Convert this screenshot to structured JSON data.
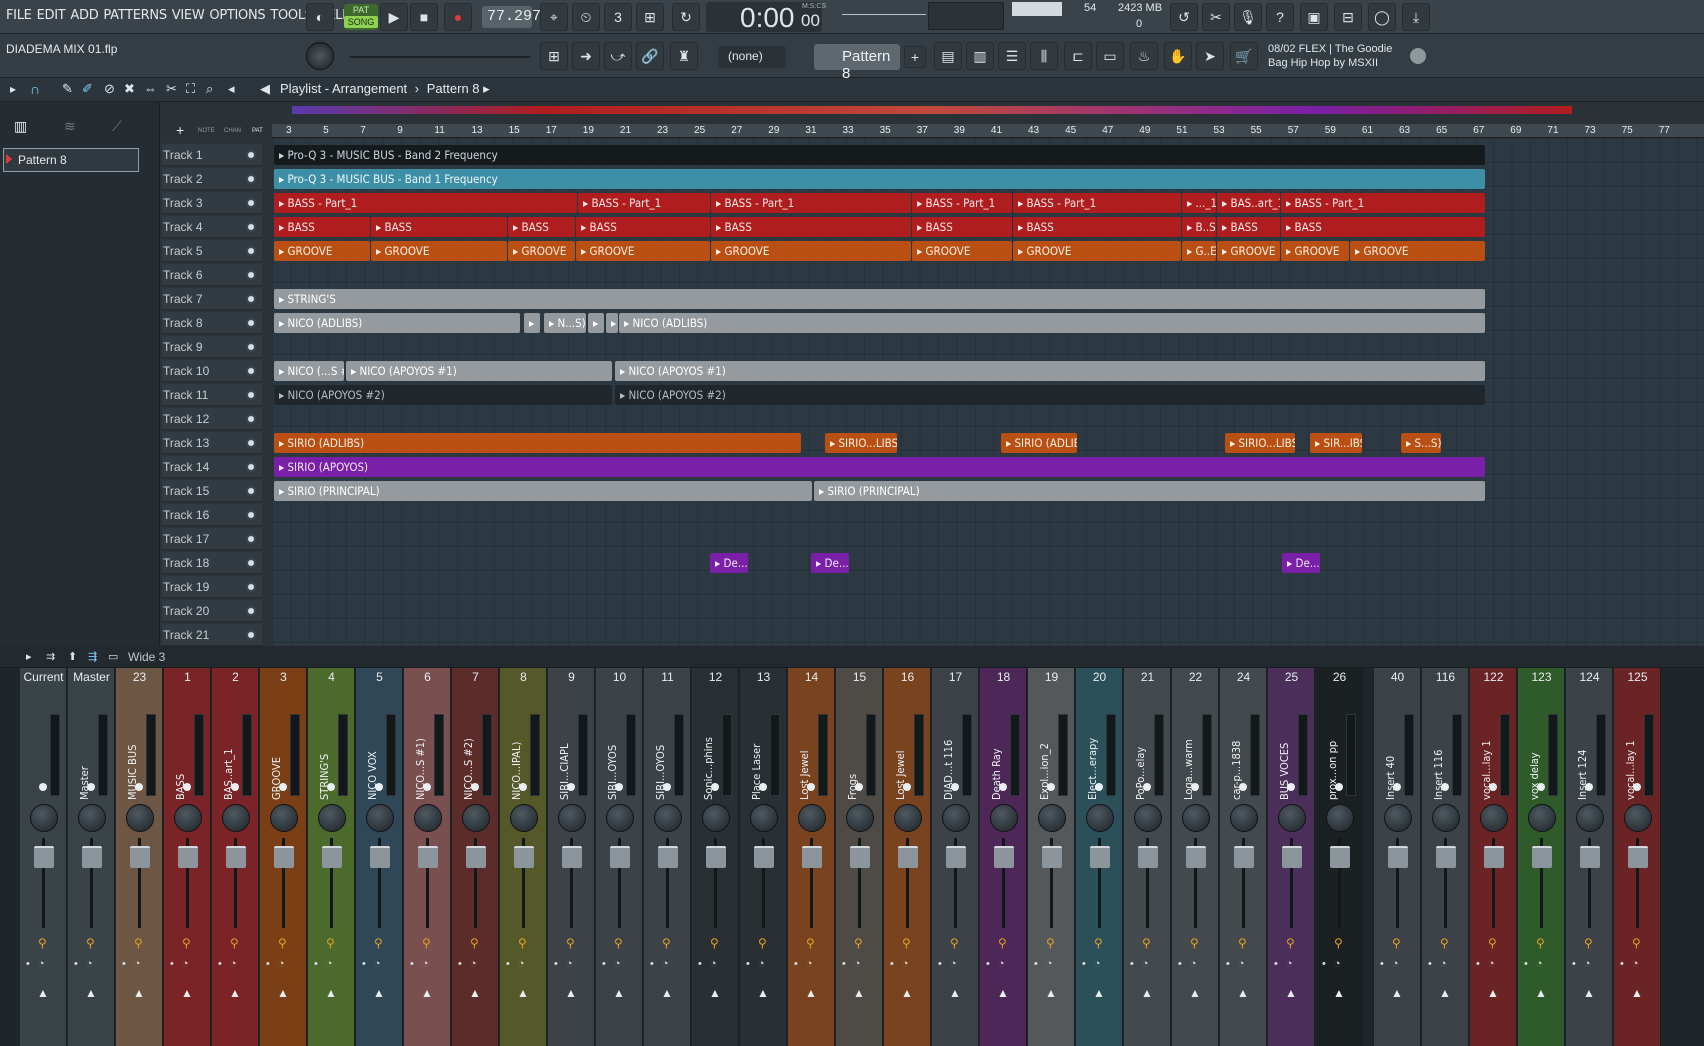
{
  "menu": [
    "FILE",
    "EDIT",
    "ADD",
    "PATTERNS",
    "VIEW",
    "OPTIONS",
    "TOOLS",
    "HELP"
  ],
  "transport": {
    "mode_top": "PAT",
    "mode_bottom": "SONG",
    "tempo": "77.297",
    "time": "0:00",
    "time_small": "00",
    "time_label": "M:S:CS",
    "cpu": "54",
    "memory": "2423 MB",
    "voices": "0"
  },
  "project": {
    "filename": "DIADEMA MIX 01.flp",
    "snap": "(none)",
    "pattern": "Pattern 8"
  },
  "news": {
    "line1": "08/02  FLEX | The Goodie",
    "line2": "Bag Hip Hop by MSXII"
  },
  "playlist": {
    "title": "Playlist - Arrangement",
    "separator": "›",
    "pattern": "Pattern 8",
    "left_labels": [
      "NOTE",
      "CHAN",
      "PAT"
    ]
  },
  "pattern_list": [
    {
      "label": "Pattern 8"
    }
  ],
  "ruler": [
    "3",
    "5",
    "7",
    "9",
    "11",
    "13",
    "15",
    "17",
    "19",
    "21",
    "23",
    "25",
    "27",
    "29",
    "31",
    "33",
    "35",
    "37",
    "39",
    "41",
    "43",
    "45",
    "47",
    "49",
    "51",
    "53",
    "55",
    "57",
    "59",
    "61",
    "63",
    "65",
    "67",
    "69",
    "71",
    "73",
    "75",
    "77"
  ],
  "tracks": [
    "Track 1",
    "Track 2",
    "Track 3",
    "Track 4",
    "Track 5",
    "Track 6",
    "Track 7",
    "Track 8",
    "Track 9",
    "Track 10",
    "Track 11",
    "Track 12",
    "Track 13",
    "Track 14",
    "Track 15",
    "Track 16",
    "Track 17",
    "Track 18",
    "Track 19",
    "Track 20",
    "Track 21"
  ],
  "clips": [
    {
      "row": 0,
      "start": 0,
      "len": 1211,
      "label": "Pro-Q 3 - MUSIC BUS - Band 2 Frequency",
      "color": "black"
    },
    {
      "row": 1,
      "start": 0,
      "len": 1211,
      "label": "Pro-Q 3 - MUSIC BUS - Band 1 Frequency",
      "color": "blue"
    },
    {
      "row": 2,
      "start": 0,
      "len": 303,
      "label": "BASS - Part_1",
      "color": "red"
    },
    {
      "row": 2,
      "start": 304,
      "len": 132,
      "label": "BASS - Part_1",
      "color": "red"
    },
    {
      "row": 2,
      "start": 437,
      "len": 200,
      "label": "BASS - Part_1",
      "color": "red"
    },
    {
      "row": 2,
      "start": 638,
      "len": 100,
      "label": "BASS - Part_1",
      "color": "red"
    },
    {
      "row": 2,
      "start": 739,
      "len": 168,
      "label": "BASS - Part_1",
      "color": "red"
    },
    {
      "row": 2,
      "start": 908,
      "len": 34,
      "label": "..._1",
      "color": "red"
    },
    {
      "row": 2,
      "start": 943,
      "len": 63,
      "label": "BAS..art_1",
      "color": "red"
    },
    {
      "row": 2,
      "start": 1007,
      "len": 204,
      "label": "BASS - Part_1",
      "color": "red"
    },
    {
      "row": 3,
      "start": 0,
      "len": 96,
      "label": "BASS",
      "color": "red"
    },
    {
      "row": 3,
      "start": 97,
      "len": 136,
      "label": "BASS",
      "color": "red"
    },
    {
      "row": 3,
      "start": 234,
      "len": 67,
      "label": "BASS",
      "color": "red"
    },
    {
      "row": 3,
      "start": 302,
      "len": 134,
      "label": "BASS",
      "color": "red"
    },
    {
      "row": 3,
      "start": 437,
      "len": 200,
      "label": "BASS",
      "color": "red"
    },
    {
      "row": 3,
      "start": 638,
      "len": 100,
      "label": "BASS",
      "color": "red"
    },
    {
      "row": 3,
      "start": 739,
      "len": 168,
      "label": "BASS",
      "color": "red"
    },
    {
      "row": 3,
      "start": 908,
      "len": 34,
      "label": "B..S",
      "color": "red"
    },
    {
      "row": 3,
      "start": 943,
      "len": 63,
      "label": "BASS",
      "color": "red"
    },
    {
      "row": 3,
      "start": 1007,
      "len": 204,
      "label": "BASS",
      "color": "red"
    },
    {
      "row": 4,
      "start": 0,
      "len": 96,
      "label": "GROOVE",
      "color": "orange"
    },
    {
      "row": 4,
      "start": 97,
      "len": 136,
      "label": "GROOVE",
      "color": "orange"
    },
    {
      "row": 4,
      "start": 234,
      "len": 67,
      "label": "GROOVE",
      "color": "orange"
    },
    {
      "row": 4,
      "start": 302,
      "len": 134,
      "label": "GROOVE",
      "color": "orange"
    },
    {
      "row": 4,
      "start": 437,
      "len": 200,
      "label": "GROOVE",
      "color": "orange"
    },
    {
      "row": 4,
      "start": 638,
      "len": 100,
      "label": "GROOVE",
      "color": "orange"
    },
    {
      "row": 4,
      "start": 739,
      "len": 168,
      "label": "GROOVE",
      "color": "orange"
    },
    {
      "row": 4,
      "start": 908,
      "len": 34,
      "label": "G..E",
      "color": "orange"
    },
    {
      "row": 4,
      "start": 943,
      "len": 63,
      "label": "GROOVE",
      "color": "orange"
    },
    {
      "row": 4,
      "start": 1007,
      "len": 68,
      "label": "GROOVE",
      "color": "orange"
    },
    {
      "row": 4,
      "start": 1076,
      "len": 135,
      "label": "GROOVE",
      "color": "orange"
    },
    {
      "row": 6,
      "start": 0,
      "len": 1211,
      "label": "STRING'S",
      "color": "grey"
    },
    {
      "row": 7,
      "start": 0,
      "len": 246,
      "label": "NICO (ADLIBS)",
      "color": "grey"
    },
    {
      "row": 7,
      "start": 250,
      "len": 16,
      "label": "",
      "color": "grey"
    },
    {
      "row": 7,
      "start": 270,
      "len": 42,
      "label": "N...S)",
      "color": "grey"
    },
    {
      "row": 7,
      "start": 314,
      "len": 16,
      "label": "",
      "color": "grey"
    },
    {
      "row": 7,
      "start": 332,
      "len": 12,
      "label": "",
      "color": "grey"
    },
    {
      "row": 7,
      "start": 345,
      "len": 866,
      "label": "NICO (ADLIBS)",
      "color": "grey"
    },
    {
      "row": 9,
      "start": 0,
      "len": 70,
      "label": "NICO (...S #1)",
      "color": "grey"
    },
    {
      "row": 9,
      "start": 72,
      "len": 266,
      "label": "NICO (APOYOS #1)",
      "color": "grey"
    },
    {
      "row": 9,
      "start": 341,
      "len": 870,
      "label": "NICO (APOYOS #1)",
      "color": "grey"
    },
    {
      "row": 10,
      "start": 0,
      "len": 338,
      "label": "NICO (APOYOS #2)",
      "color": "dark"
    },
    {
      "row": 10,
      "start": 341,
      "len": 870,
      "label": "NICO (APOYOS #2)",
      "color": "dark"
    },
    {
      "row": 12,
      "start": 0,
      "len": 527,
      "label": "SIRIO (ADLIBS)",
      "color": "orange"
    },
    {
      "row": 12,
      "start": 551,
      "len": 72,
      "label": "SIRIO...LIBS)",
      "color": "orange"
    },
    {
      "row": 12,
      "start": 727,
      "len": 76,
      "label": "SIRIO (ADLIBS)",
      "color": "orange"
    },
    {
      "row": 12,
      "start": 951,
      "len": 70,
      "label": "SIRIO...LIBS)",
      "color": "orange"
    },
    {
      "row": 12,
      "start": 1036,
      "len": 52,
      "label": "SIR...IBS)",
      "color": "orange"
    },
    {
      "row": 12,
      "start": 1127,
      "len": 40,
      "label": "S...S)",
      "color": "orange"
    },
    {
      "row": 13,
      "start": 0,
      "len": 1211,
      "label": "SIRIO (APOYOS)",
      "color": "purple"
    },
    {
      "row": 14,
      "start": 0,
      "len": 538,
      "label": "SIRIO (PRINCIPAL)",
      "color": "grey"
    },
    {
      "row": 14,
      "start": 540,
      "len": 671,
      "label": "SIRIO (PRINCIPAL)",
      "color": "grey"
    },
    {
      "row": 17,
      "start": 436,
      "len": 38,
      "label": "De...y",
      "color": "purple"
    },
    {
      "row": 17,
      "start": 537,
      "len": 38,
      "label": "De...y",
      "color": "purple"
    },
    {
      "row": 17,
      "start": 1008,
      "len": 38,
      "label": "De...y",
      "color": "purple"
    }
  ],
  "mixer": {
    "title": "Wide 3",
    "strips": [
      {
        "num": "Current",
        "name": "",
        "color": "#3a4348"
      },
      {
        "num": "Master",
        "name": "Master",
        "color": "#3a4348"
      },
      {
        "num": "23",
        "name": "MUSIC BUS",
        "color": "#6e5644"
      },
      {
        "num": "1",
        "name": "BASS",
        "color": "#7a2427"
      },
      {
        "num": "2",
        "name": "BAS..art_1",
        "color": "#7a2427"
      },
      {
        "num": "3",
        "name": "GROOVE",
        "color": "#7a3f14"
      },
      {
        "num": "4",
        "name": "STRING'S",
        "color": "#4d6a2d"
      },
      {
        "num": "5",
        "name": "NICO VOX",
        "color": "#2f4757"
      },
      {
        "num": "6",
        "name": "NICO...S #1)",
        "color": "#7a4f50"
      },
      {
        "num": "7",
        "name": "NICO...S #2)",
        "color": "#5b2c2a"
      },
      {
        "num": "8",
        "name": "NICO...IPAL)",
        "color": "#55592a"
      },
      {
        "num": "9",
        "name": "SIRI...CIAPL",
        "color": "#3c4247"
      },
      {
        "num": "10",
        "name": "SIRI...OYOS",
        "color": "#3c4247"
      },
      {
        "num": "11",
        "name": "SIRI...OYOS",
        "color": "#3c4247"
      },
      {
        "num": "12",
        "name": "Sonic...phins",
        "color": "#2a2f33"
      },
      {
        "num": "13",
        "name": "Place Laser",
        "color": "#2a2f33"
      },
      {
        "num": "14",
        "name": "Lost Jewel",
        "color": "#7a4320"
      },
      {
        "num": "15",
        "name": "Frogs",
        "color": "#4e4a46"
      },
      {
        "num": "16",
        "name": "Lost Jewel",
        "color": "#7a4320"
      },
      {
        "num": "17",
        "name": "DIAD...t 116",
        "color": "#3c4247"
      },
      {
        "num": "18",
        "name": "Death Ray",
        "color": "#4d2757"
      },
      {
        "num": "19",
        "name": "Expl...ion_2",
        "color": "#55585b"
      },
      {
        "num": "20",
        "name": "Elect...erapy",
        "color": "#2c5059"
      },
      {
        "num": "21",
        "name": "PoPo...elay",
        "color": "#44494d"
      },
      {
        "num": "22",
        "name": "Loga...warm",
        "color": "#44494d"
      },
      {
        "num": "24",
        "name": "car-p...1838",
        "color": "#44494d"
      },
      {
        "num": "25",
        "name": "BUS VOCES",
        "color": "#4b2f5a"
      },
      {
        "num": "26",
        "name": "prox...on pp",
        "color": "#1b2023"
      },
      {
        "num": "40",
        "name": "Insert 40",
        "color": "#3c4247"
      },
      {
        "num": "116",
        "name": "Insert 116",
        "color": "#3c4247"
      },
      {
        "num": "122",
        "name": "vocal...lay 1",
        "color": "#6b2426"
      },
      {
        "num": "123",
        "name": "vox delay",
        "color": "#2f5a2a"
      },
      {
        "num": "124",
        "name": "Insert 124",
        "color": "#3c4247"
      },
      {
        "num": "125",
        "name": "vocal...lay 1",
        "color": "#6b2426"
      }
    ]
  }
}
